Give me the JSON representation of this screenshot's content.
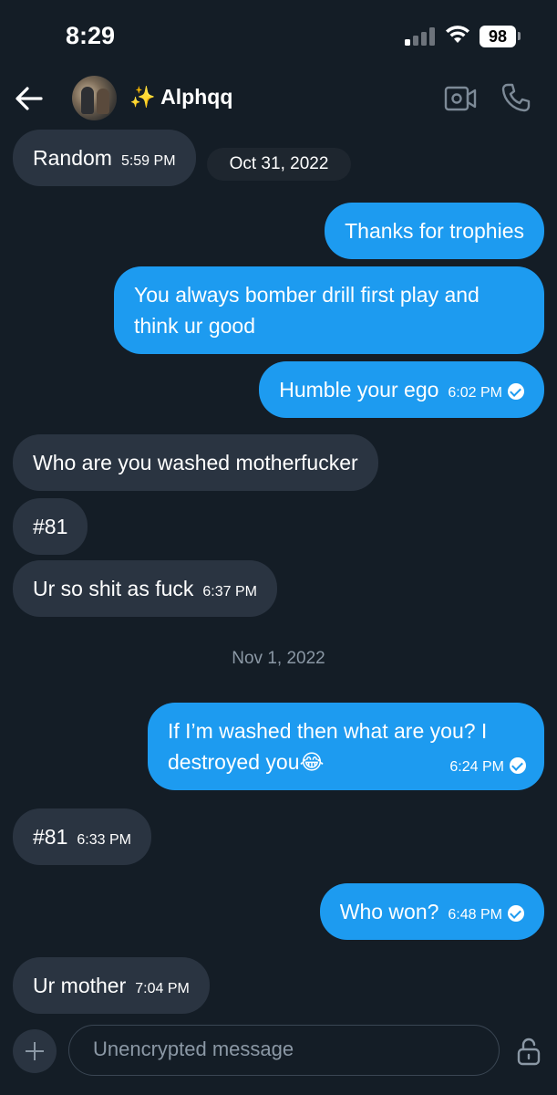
{
  "status_bar": {
    "time": "8:29",
    "battery": "98"
  },
  "header": {
    "contact_name": "✨ Alphqq"
  },
  "messages": [
    {
      "text": "Random",
      "time": "5:59 PM"
    },
    {
      "date_label": "Oct 31, 2022"
    },
    {
      "text": "Thanks for trophies"
    },
    {
      "text": "You always bomber drill first play and think ur good"
    },
    {
      "text": "Humble your ego",
      "time": "6:02 PM"
    },
    {
      "text": "Who are you washed motherfucker"
    },
    {
      "text": "#81"
    },
    {
      "text": "Ur so shit as fuck",
      "time": "6:37 PM"
    },
    {
      "date_separator": "Nov 1, 2022"
    },
    {
      "text": "If I’m washed then what are you? I destroyed you😂",
      "time": "6:24 PM"
    },
    {
      "text": "#81",
      "time": "6:33 PM"
    },
    {
      "text": "Who won?",
      "time": "6:48 PM"
    },
    {
      "text": "Ur mother",
      "time": "7:04 PM"
    }
  ],
  "composer": {
    "placeholder": "Unencrypted message"
  },
  "colors": {
    "background": "#141d26",
    "outgoing": "#1d9bf0",
    "incoming": "#2a3441"
  }
}
